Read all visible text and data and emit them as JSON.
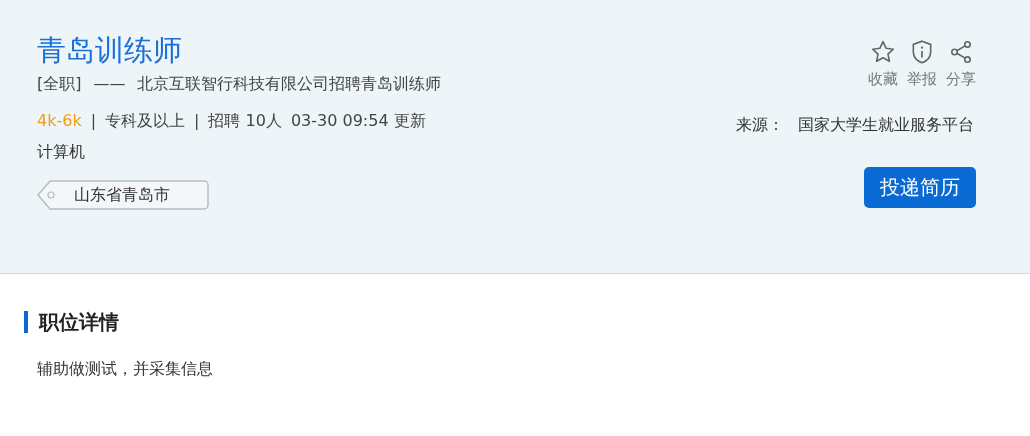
{
  "job": {
    "title": "青岛训练师",
    "type": "[全职]",
    "dash": "——",
    "subtitle": "北京互联智行科技有限公司招聘青岛训练师",
    "meta": [
      {
        "kind": "salary",
        "text": "4k-6k"
      },
      {
        "kind": "sep",
        "text": "|"
      },
      {
        "kind": "plain",
        "text": "专科及以上"
      },
      {
        "kind": "sep",
        "text": "|"
      },
      {
        "kind": "plain",
        "text": "招聘 10人"
      },
      {
        "kind": "plain",
        "text": "03-30 09:54 更新"
      }
    ],
    "major": "计算机",
    "location": "山东省青岛市"
  },
  "actions": [
    {
      "kind": "star",
      "label": "收藏"
    },
    {
      "kind": "report",
      "label": "举报"
    },
    {
      "kind": "share",
      "label": "分享"
    }
  ],
  "source": {
    "label": "来源：",
    "value": "国家大学生就业服务平台"
  },
  "apply_button": "投递简历",
  "details": {
    "heading": "职位详情",
    "text": "辅助做测试，并采集信息"
  }
}
